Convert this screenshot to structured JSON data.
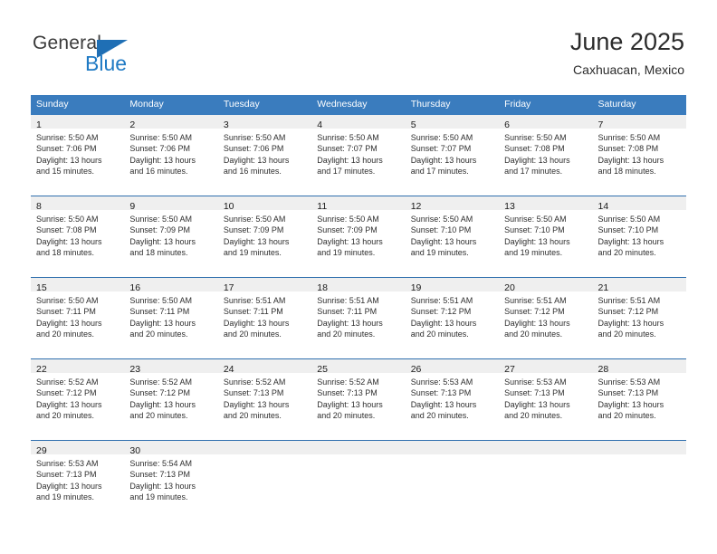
{
  "logo": {
    "word1": "General",
    "word2": "Blue",
    "triangle_color": "#1f6fb5",
    "word2_color": "#1f7ac4"
  },
  "header": {
    "title": "June 2025",
    "subtitle": "Caxhuacan, Mexico"
  },
  "theme": {
    "header_blue": "#3a7cbe",
    "row_divider_blue": "#2f6fae",
    "day_band_gray": "#efefef"
  },
  "weekdays": [
    "Sunday",
    "Monday",
    "Tuesday",
    "Wednesday",
    "Thursday",
    "Friday",
    "Saturday"
  ],
  "weeks": [
    {
      "days": [
        {
          "num": "1",
          "lines": [
            "Sunrise: 5:50 AM",
            "Sunset: 7:06 PM",
            "Daylight: 13 hours",
            "and 15 minutes."
          ]
        },
        {
          "num": "2",
          "lines": [
            "Sunrise: 5:50 AM",
            "Sunset: 7:06 PM",
            "Daylight: 13 hours",
            "and 16 minutes."
          ]
        },
        {
          "num": "3",
          "lines": [
            "Sunrise: 5:50 AM",
            "Sunset: 7:06 PM",
            "Daylight: 13 hours",
            "and 16 minutes."
          ]
        },
        {
          "num": "4",
          "lines": [
            "Sunrise: 5:50 AM",
            "Sunset: 7:07 PM",
            "Daylight: 13 hours",
            "and 17 minutes."
          ]
        },
        {
          "num": "5",
          "lines": [
            "Sunrise: 5:50 AM",
            "Sunset: 7:07 PM",
            "Daylight: 13 hours",
            "and 17 minutes."
          ]
        },
        {
          "num": "6",
          "lines": [
            "Sunrise: 5:50 AM",
            "Sunset: 7:08 PM",
            "Daylight: 13 hours",
            "and 17 minutes."
          ]
        },
        {
          "num": "7",
          "lines": [
            "Sunrise: 5:50 AM",
            "Sunset: 7:08 PM",
            "Daylight: 13 hours",
            "and 18 minutes."
          ]
        }
      ]
    },
    {
      "days": [
        {
          "num": "8",
          "lines": [
            "Sunrise: 5:50 AM",
            "Sunset: 7:08 PM",
            "Daylight: 13 hours",
            "and 18 minutes."
          ]
        },
        {
          "num": "9",
          "lines": [
            "Sunrise: 5:50 AM",
            "Sunset: 7:09 PM",
            "Daylight: 13 hours",
            "and 18 minutes."
          ]
        },
        {
          "num": "10",
          "lines": [
            "Sunrise: 5:50 AM",
            "Sunset: 7:09 PM",
            "Daylight: 13 hours",
            "and 19 minutes."
          ]
        },
        {
          "num": "11",
          "lines": [
            "Sunrise: 5:50 AM",
            "Sunset: 7:09 PM",
            "Daylight: 13 hours",
            "and 19 minutes."
          ]
        },
        {
          "num": "12",
          "lines": [
            "Sunrise: 5:50 AM",
            "Sunset: 7:10 PM",
            "Daylight: 13 hours",
            "and 19 minutes."
          ]
        },
        {
          "num": "13",
          "lines": [
            "Sunrise: 5:50 AM",
            "Sunset: 7:10 PM",
            "Daylight: 13 hours",
            "and 19 minutes."
          ]
        },
        {
          "num": "14",
          "lines": [
            "Sunrise: 5:50 AM",
            "Sunset: 7:10 PM",
            "Daylight: 13 hours",
            "and 20 minutes."
          ]
        }
      ]
    },
    {
      "days": [
        {
          "num": "15",
          "lines": [
            "Sunrise: 5:50 AM",
            "Sunset: 7:11 PM",
            "Daylight: 13 hours",
            "and 20 minutes."
          ]
        },
        {
          "num": "16",
          "lines": [
            "Sunrise: 5:50 AM",
            "Sunset: 7:11 PM",
            "Daylight: 13 hours",
            "and 20 minutes."
          ]
        },
        {
          "num": "17",
          "lines": [
            "Sunrise: 5:51 AM",
            "Sunset: 7:11 PM",
            "Daylight: 13 hours",
            "and 20 minutes."
          ]
        },
        {
          "num": "18",
          "lines": [
            "Sunrise: 5:51 AM",
            "Sunset: 7:11 PM",
            "Daylight: 13 hours",
            "and 20 minutes."
          ]
        },
        {
          "num": "19",
          "lines": [
            "Sunrise: 5:51 AM",
            "Sunset: 7:12 PM",
            "Daylight: 13 hours",
            "and 20 minutes."
          ]
        },
        {
          "num": "20",
          "lines": [
            "Sunrise: 5:51 AM",
            "Sunset: 7:12 PM",
            "Daylight: 13 hours",
            "and 20 minutes."
          ]
        },
        {
          "num": "21",
          "lines": [
            "Sunrise: 5:51 AM",
            "Sunset: 7:12 PM",
            "Daylight: 13 hours",
            "and 20 minutes."
          ]
        }
      ]
    },
    {
      "days": [
        {
          "num": "22",
          "lines": [
            "Sunrise: 5:52 AM",
            "Sunset: 7:12 PM",
            "Daylight: 13 hours",
            "and 20 minutes."
          ]
        },
        {
          "num": "23",
          "lines": [
            "Sunrise: 5:52 AM",
            "Sunset: 7:12 PM",
            "Daylight: 13 hours",
            "and 20 minutes."
          ]
        },
        {
          "num": "24",
          "lines": [
            "Sunrise: 5:52 AM",
            "Sunset: 7:13 PM",
            "Daylight: 13 hours",
            "and 20 minutes."
          ]
        },
        {
          "num": "25",
          "lines": [
            "Sunrise: 5:52 AM",
            "Sunset: 7:13 PM",
            "Daylight: 13 hours",
            "and 20 minutes."
          ]
        },
        {
          "num": "26",
          "lines": [
            "Sunrise: 5:53 AM",
            "Sunset: 7:13 PM",
            "Daylight: 13 hours",
            "and 20 minutes."
          ]
        },
        {
          "num": "27",
          "lines": [
            "Sunrise: 5:53 AM",
            "Sunset: 7:13 PM",
            "Daylight: 13 hours",
            "and 20 minutes."
          ]
        },
        {
          "num": "28",
          "lines": [
            "Sunrise: 5:53 AM",
            "Sunset: 7:13 PM",
            "Daylight: 13 hours",
            "and 20 minutes."
          ]
        }
      ]
    },
    {
      "days": [
        {
          "num": "29",
          "lines": [
            "Sunrise: 5:53 AM",
            "Sunset: 7:13 PM",
            "Daylight: 13 hours",
            "and 19 minutes."
          ]
        },
        {
          "num": "30",
          "lines": [
            "Sunrise: 5:54 AM",
            "Sunset: 7:13 PM",
            "Daylight: 13 hours",
            "and 19 minutes."
          ]
        },
        {
          "num": "",
          "lines": []
        },
        {
          "num": "",
          "lines": []
        },
        {
          "num": "",
          "lines": []
        },
        {
          "num": "",
          "lines": []
        },
        {
          "num": "",
          "lines": []
        }
      ]
    }
  ]
}
